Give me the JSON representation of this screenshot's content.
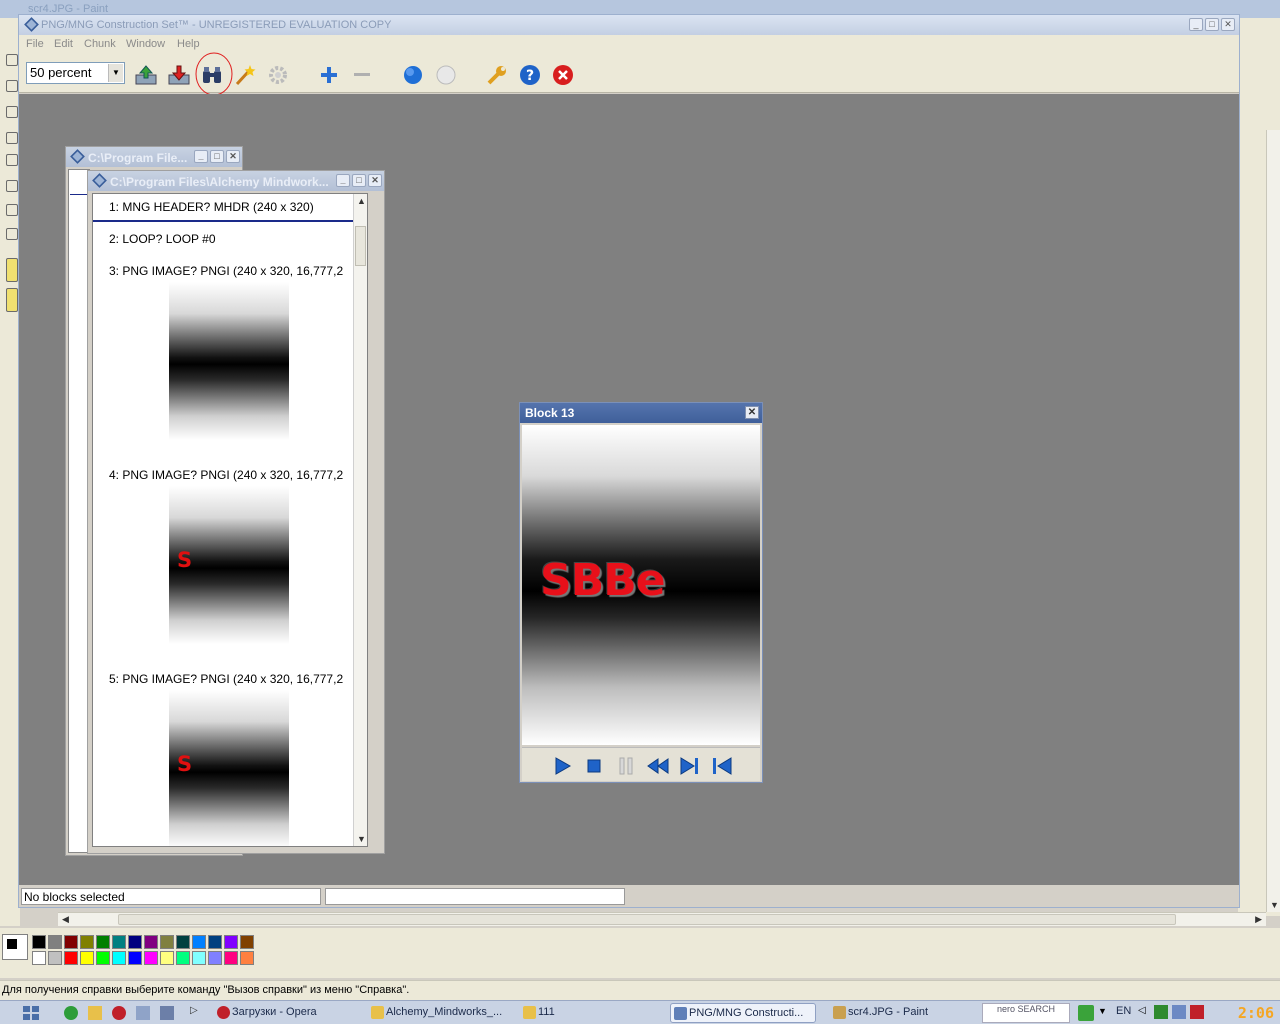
{
  "paint": {
    "title": "scr4.JPG - Paint",
    "status": "Для получения справки выберите команду \"Вызов справки\" из меню \"Справка\"."
  },
  "app": {
    "title": "PNG/MNG Construction Set™ - UNREGISTERED EVALUATION COPY",
    "menu": [
      "File",
      "Edit",
      "Chunk",
      "Window",
      "Help"
    ],
    "zoom": "50 percent",
    "status_left": "No blocks selected",
    "status_right": ""
  },
  "child_back": {
    "title": "C:\\Program File..."
  },
  "child_front": {
    "title": "C:\\Program Files\\Alchemy Mindwork...",
    "chunks": [
      {
        "label": "1: MNG HEADER? MHDR (240 x 320)"
      },
      {
        "label": "2: LOOP? LOOP #0"
      },
      {
        "label": "3: PNG IMAGE? PNGI (240 x 320, 16,777,2"
      },
      {
        "label": "4: PNG IMAGE? PNGI (240 x 320, 16,777,2",
        "thumb_text": "S"
      },
      {
        "label": "5: PNG IMAGE? PNGI (240 x 320, 16,777,2",
        "thumb_text": "S"
      }
    ]
  },
  "block13": {
    "title": "Block 13",
    "preview_text": "SBBe"
  },
  "palette": {
    "top": [
      "#000000",
      "#808080",
      "#800000",
      "#808000",
      "#008000",
      "#008080",
      "#000080",
      "#800080",
      "#808040",
      "#004040",
      "#0080ff",
      "#004080",
      "#8000ff",
      "#804000"
    ],
    "bottom": [
      "#ffffff",
      "#c0c0c0",
      "#ff0000",
      "#ffff00",
      "#00ff00",
      "#00ffff",
      "#0000ff",
      "#ff00ff",
      "#ffff80",
      "#00ff80",
      "#80ffff",
      "#8080ff",
      "#ff0080",
      "#ff8040"
    ]
  },
  "taskbar": {
    "items": [
      {
        "label": "Загрузки - Opera",
        "color": "#c0202a"
      },
      {
        "label": "Alchemy_Mindworks_...",
        "color": "#e8c04a"
      },
      {
        "label": "111",
        "color": "#e8c04a"
      },
      {
        "label": "PNG/MNG Constructi...",
        "color": "#5f7fb8",
        "active": true
      },
      {
        "label": "scr4.JPG - Paint",
        "color": "#c9a050"
      }
    ],
    "nero": "nero SEARCH",
    "lang": "EN",
    "clock": "2:06"
  }
}
